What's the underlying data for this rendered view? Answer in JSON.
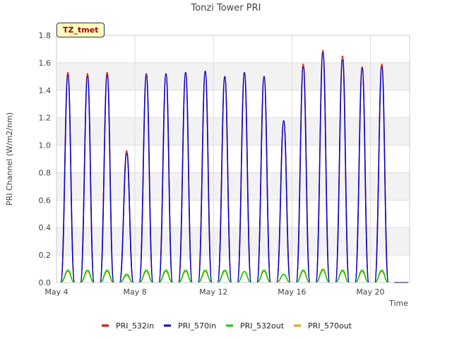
{
  "chart_data": {
    "type": "line",
    "title": "Tonzi Tower PRI",
    "xlabel": "Time",
    "ylabel": "PRI Channel (W/m2/nm)",
    "site_badge": "TZ_tmet",
    "ylim": [
      0,
      1.8
    ],
    "yticks": [
      "0.0",
      "0.2",
      "0.4",
      "0.6",
      "0.8",
      "1.0",
      "1.2",
      "1.4",
      "1.6",
      "1.8"
    ],
    "xlim": [
      "May 4",
      "May 22"
    ],
    "xticks": [
      "May 4",
      "May 8",
      "May 12",
      "May 16",
      "May 20"
    ],
    "grid": true,
    "legend_position": "bottom",
    "days": [
      "May 4",
      "May 5",
      "May 6",
      "May 7",
      "May 8",
      "May 9",
      "May 10",
      "May 11",
      "May 12",
      "May 13",
      "May 14",
      "May 15",
      "May 16",
      "May 17",
      "May 18",
      "May 19",
      "May 20",
      "May 21"
    ],
    "series": [
      {
        "name": "PRI_532in",
        "color": "#dd0000",
        "daily_peak": [
          1.53,
          1.52,
          1.53,
          0.96,
          1.5,
          1.52,
          1.52,
          1.53,
          1.49,
          1.52,
          1.5,
          1.17,
          1.59,
          1.69,
          1.65,
          1.57,
          1.59,
          0.0
        ]
      },
      {
        "name": "PRI_570in",
        "color": "#0000cc",
        "daily_peak": [
          1.51,
          1.5,
          1.51,
          0.94,
          1.52,
          1.52,
          1.53,
          1.54,
          1.5,
          1.53,
          1.5,
          1.18,
          1.57,
          1.67,
          1.62,
          1.56,
          1.57,
          0.0
        ]
      },
      {
        "name": "PRI_532out",
        "color": "#00cc00",
        "daily_peak": [
          0.09,
          0.09,
          0.09,
          0.06,
          0.09,
          0.09,
          0.09,
          0.09,
          0.09,
          0.08,
          0.09,
          0.06,
          0.09,
          0.09,
          0.09,
          0.09,
          0.09,
          0.0
        ]
      },
      {
        "name": "PRI_570out",
        "color": "#e6a000",
        "daily_peak": [
          0.08,
          0.08,
          0.08,
          0.05,
          0.08,
          0.08,
          0.08,
          0.08,
          0.08,
          0.08,
          0.08,
          0.06,
          0.08,
          0.1,
          0.08,
          0.08,
          0.08,
          0.0
        ]
      }
    ]
  }
}
